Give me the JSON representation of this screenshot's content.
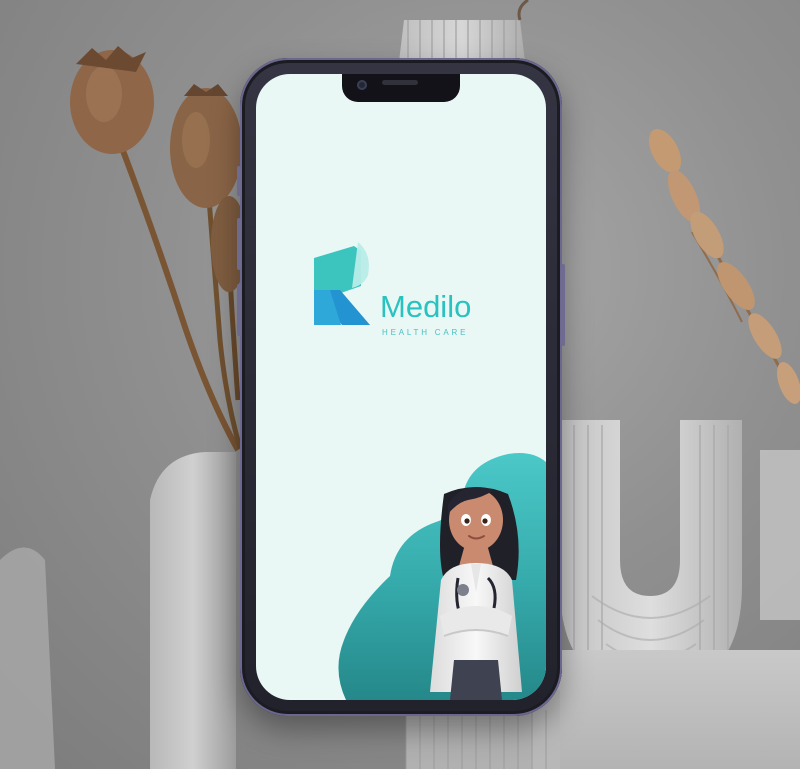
{
  "app": {
    "brand_name": "Medilo",
    "tagline": "HEALTH CARE"
  },
  "colors": {
    "screen_background": "#e9f7f5",
    "brand_teal": "#29c2bf",
    "brand_blue": "#2d9ad1",
    "blob_teal": "#47c5c6",
    "blob_dark_teal": "#2c8c8d",
    "phone_frame": "#2b2b35",
    "background_gray": "#909090"
  },
  "icons": {
    "logo": "medilo-logo-icon",
    "illustration": "doctor-illustration"
  }
}
